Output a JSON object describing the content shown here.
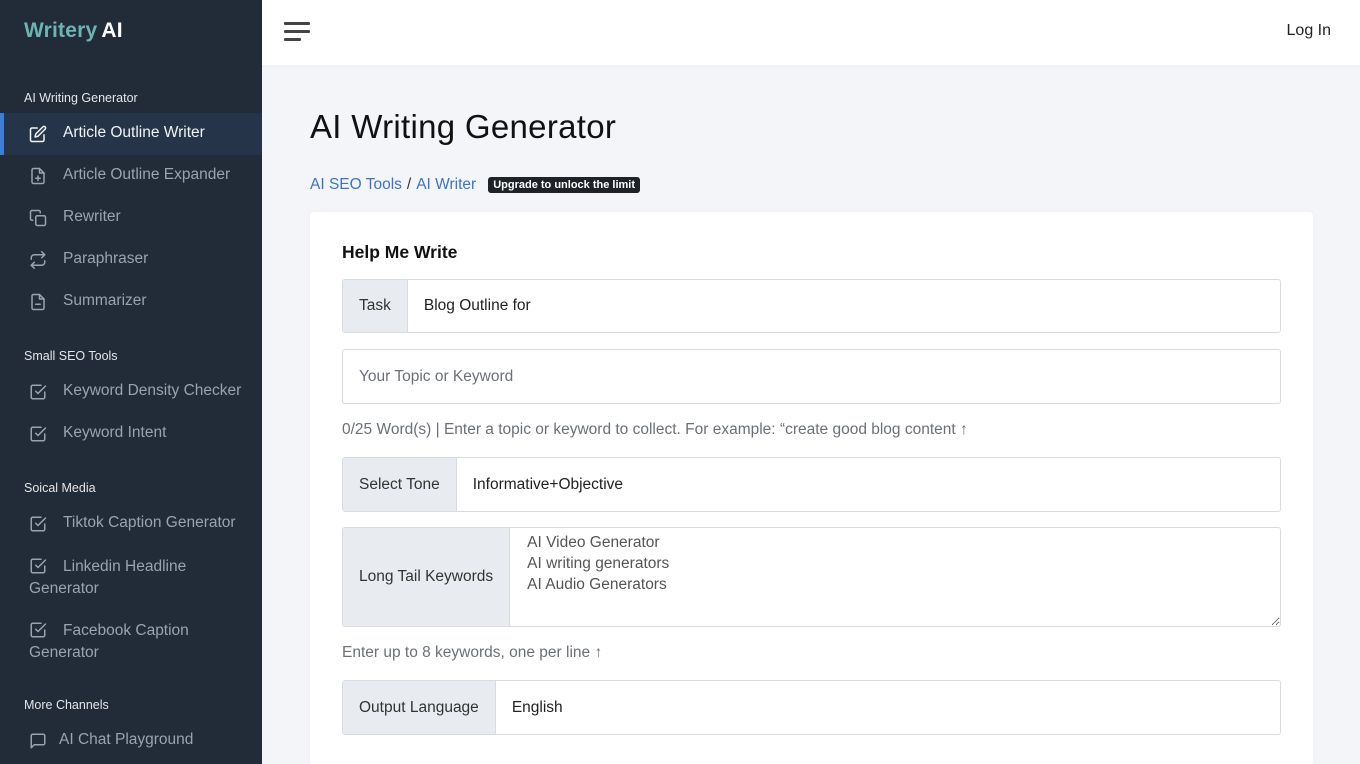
{
  "sidebar": {
    "logo": {
      "brand": "Writery",
      "suffix": "AI"
    },
    "sections": [
      {
        "title": "AI Writing Generator"
      },
      {
        "title": "Small SEO Tools"
      },
      {
        "title": "Soical Media"
      },
      {
        "title": "More Channels"
      }
    ],
    "items": [
      {
        "label": "Article Outline Writer",
        "icon": "edit-icon",
        "active": true
      },
      {
        "label": "Article Outline Expander",
        "icon": "file-plus-icon"
      },
      {
        "label": "Rewriter",
        "icon": "copy-icon"
      },
      {
        "label": "Paraphraser",
        "icon": "repeat-icon"
      },
      {
        "label": "Summarizer",
        "icon": "file-minus-icon"
      },
      {
        "label": "Keyword Density Checker",
        "icon": "check-square-icon"
      },
      {
        "label": "Keyword Intent",
        "icon": "check-square-icon"
      },
      {
        "label": "Tiktok Caption Generator",
        "icon": "check-square-icon"
      },
      {
        "label": "Linkedin Headline Generator",
        "icon": "check-square-icon"
      },
      {
        "label": "Facebook Caption Generator",
        "icon": "check-square-icon"
      },
      {
        "label": "AI Chat Playground",
        "icon": "message-square-icon"
      }
    ]
  },
  "topbar": {
    "menu_icon": "hamburger-icon",
    "login_label": "Log In"
  },
  "main": {
    "title": "AI Writing Generator",
    "breadcrumb": [
      {
        "label": "AI SEO Tools"
      },
      {
        "label": "AI Writer"
      }
    ],
    "breadcrumb_separator": "/",
    "badge": "Upgrade to unlock the limit",
    "form": {
      "title": "Help Me Write",
      "task": {
        "label": "Task",
        "value": "Blog Outline for"
      },
      "topic": {
        "placeholder": "Your Topic or Keyword",
        "value": ""
      },
      "topic_help": "0/25 Word(s) | Enter a topic or keyword to collect. For example: “create good blog content ↑",
      "tone": {
        "label": "Select Tone",
        "value": "Informative+Objective"
      },
      "keywords": {
        "label": "Long Tail Keywords",
        "value": "AI Video Generator\nAI writing generators\nAI Audio Generators"
      },
      "keywords_help": "Enter up to 8 keywords, one per line ↑",
      "language": {
        "label": "Output Language",
        "value": "English"
      }
    }
  },
  "colors": {
    "sidebar_bg": "#222b38",
    "brand": "#6cb5b2",
    "active_accent": "#3d7fd7",
    "link": "#3d74c4",
    "badge_bg": "#1f2226"
  }
}
